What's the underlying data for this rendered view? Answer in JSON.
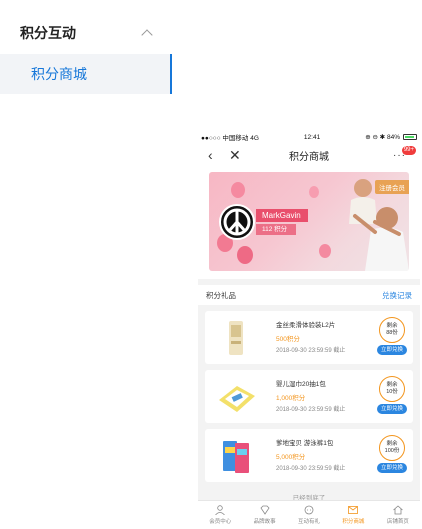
{
  "menu": {
    "group_title": "积分互动",
    "active_item": "积分商城"
  },
  "phone": {
    "status": {
      "carrier": "●●○○○ 中国移动  4G",
      "time": "12:41",
      "right": "⊕ ⊖ ✱ 84%"
    },
    "nav": {
      "title": "积分商城",
      "badge": "99+",
      "more": "···"
    },
    "banner": {
      "member_tag": "注册会员",
      "name": "MarkGavin",
      "points": "112 积分"
    },
    "section": {
      "title": "积分礼品",
      "link": "兑换记录"
    },
    "gifts": [
      {
        "name": "金丝柔滑体验装L2片",
        "points": "500积分",
        "date": "2018-09-30 23:59:59 截止",
        "remain_label": "剩余",
        "remain_count": "88份",
        "button": "立即兑换"
      },
      {
        "name": "婴儿湿巾20抽1包",
        "points": "1,000积分",
        "date": "2018-09-30 23:59:59 截止",
        "remain_label": "剩余",
        "remain_count": "10份",
        "button": "立即兑换"
      },
      {
        "name": "爹地宝贝 游泳裤1包",
        "points": "5,000积分",
        "date": "2018-09-30 23:59:59 截止",
        "remain_label": "剩余",
        "remain_count": "100份",
        "button": "立即兑换"
      }
    ],
    "bottom_tip": "已经到底了",
    "tabs": [
      "会员中心",
      "品牌故事",
      "互动有礼",
      "积分商城",
      "店铺首页"
    ]
  },
  "colors": {
    "accent_blue": "#1677d9",
    "orange": "#f3951d",
    "pink": "#e94f6c"
  }
}
